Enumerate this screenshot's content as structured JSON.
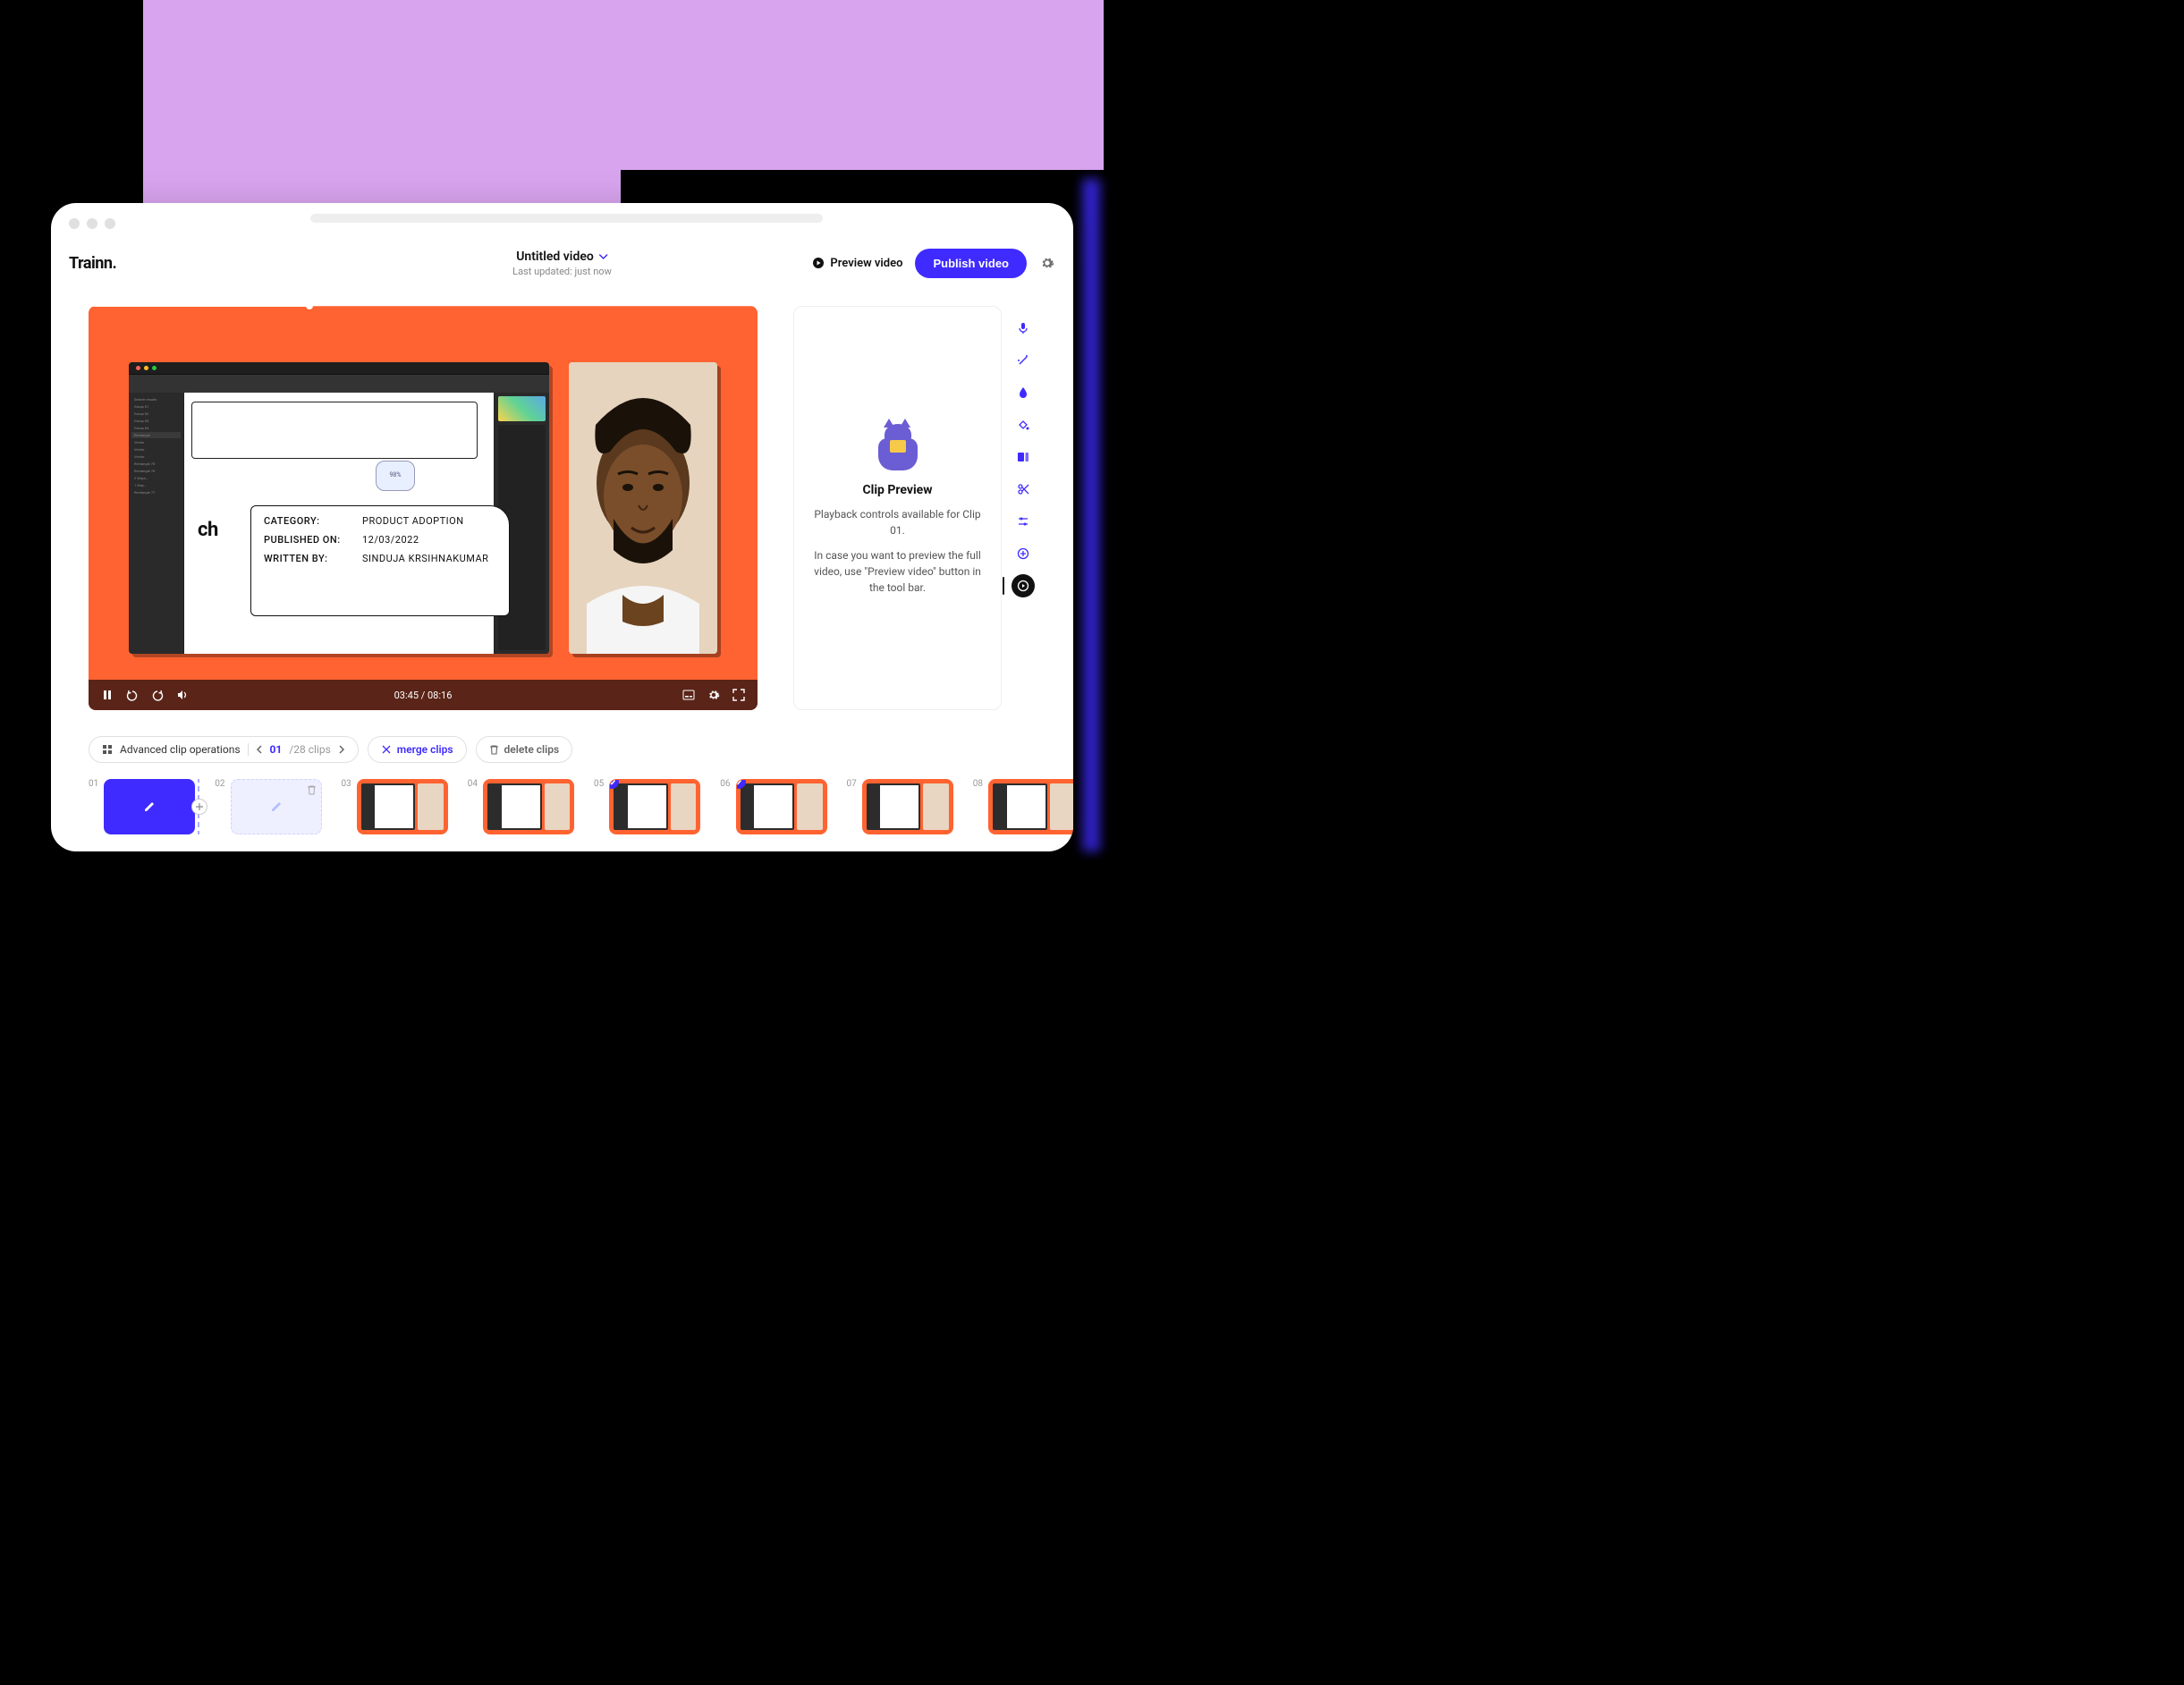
{
  "logo": "Trainn",
  "title": "Untitled video",
  "subtitle": "Last updated: just now",
  "header": {
    "preview": "Preview video",
    "publish": "Publish video"
  },
  "video": {
    "meta": {
      "heading_suffix": "ch",
      "category_k": "CATEGORY:",
      "category_v": "PRODUCT ADOPTION",
      "published_k": "PUBLISHED ON:",
      "published_v": "12/03/2022",
      "written_k": "WRITTEN BY:",
      "written_v": "SINDUJA KRSIHNAKUMAR"
    },
    "badge": "98%",
    "time": "03:45 / 08:16"
  },
  "preview_panel": {
    "title": "Clip Preview",
    "line1": "Playback controls available for Clip 01.",
    "line2": "In case you want to preview the full video, use \"Preview video\" button in the tool bar."
  },
  "ops": {
    "advanced": "Advanced clip operations",
    "current": "01",
    "total": "/28 clips",
    "merge": "merge clips",
    "delete": "delete clips"
  },
  "clips": [
    {
      "num": "01"
    },
    {
      "num": "02"
    },
    {
      "num": "03"
    },
    {
      "num": "04"
    },
    {
      "num": "05"
    },
    {
      "num": "06"
    },
    {
      "num": "07"
    },
    {
      "num": "08"
    }
  ]
}
